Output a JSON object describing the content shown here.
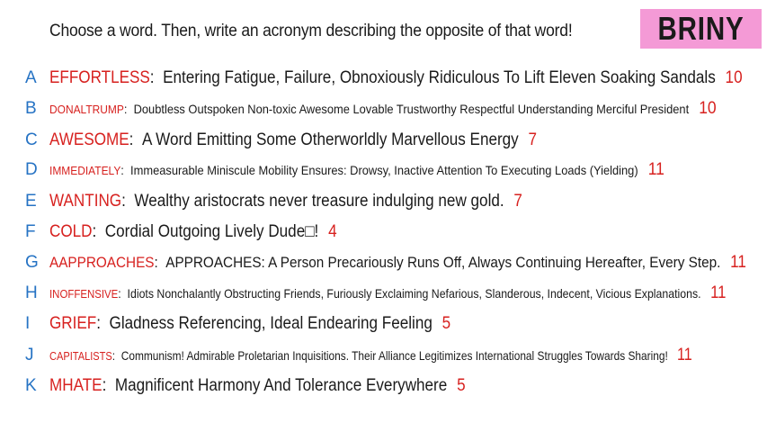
{
  "prompt": "Choose a word. Then, write an acronym describing the opposite of that word!",
  "badge": "BRINY",
  "colors": {
    "letter": "#2673c4",
    "word": "#d7211f",
    "count": "#d7211f",
    "badge_bg": "#f49ad6"
  },
  "entries": [
    {
      "letter": "A",
      "word": "EFFORTLESS",
      "text": "Entering Fatigue, Failure, Obnoxiously Ridiculous To Lift Eleven Soaking Sandals",
      "count": "10"
    },
    {
      "letter": "B",
      "word": "DONALTRUMP",
      "text": "Doubtless Outspoken Non-toxic Awesome Lovable Trustworthy Respectful Understanding Merciful President",
      "count": "10"
    },
    {
      "letter": "C",
      "word": "AWESOME",
      "text": "A Word Emitting Some Otherworldly Marvellous Energy",
      "count": "7"
    },
    {
      "letter": "D",
      "word": "IMMEDIATELY",
      "text": "Immeasurable Miniscule Mobility Ensures: Drowsy, Inactive Attention To Executing Loads (Yielding)",
      "count": "11"
    },
    {
      "letter": "E",
      "word": "WANTING",
      "text": "Wealthy aristocrats never treasure indulging new gold.",
      "count": "7"
    },
    {
      "letter": "F",
      "word": "COLD",
      "text": "Cordial Outgoing Lively Dude□!",
      "count": "4"
    },
    {
      "letter": "G",
      "word": "AAPPROACHES",
      "text": "APPROACHES: A Person Precariously Runs Off, Always Continuing Hereafter, Every Step.",
      "count": "11"
    },
    {
      "letter": "H",
      "word": "INOFFENSIVE",
      "text": "Idiots Nonchalantly Obstructing Friends, Furiously Exclaiming Nefarious, Slanderous, Indecent, Vicious Explanations.",
      "count": "11"
    },
    {
      "letter": "I",
      "word": "GRIEF",
      "text": "Gladness Referencing, Ideal Endearing Feeling",
      "count": "5"
    },
    {
      "letter": "J",
      "word": "CAPITALISTS",
      "text": "Communism! Admirable Proletarian Inquisitions. Their Alliance Legitimizes International Struggles Towards Sharing!",
      "count": "11"
    },
    {
      "letter": "K",
      "word": "MHATE",
      "text": "Magnificent  Harmony And Tolerance Everywhere",
      "count": "5"
    }
  ]
}
